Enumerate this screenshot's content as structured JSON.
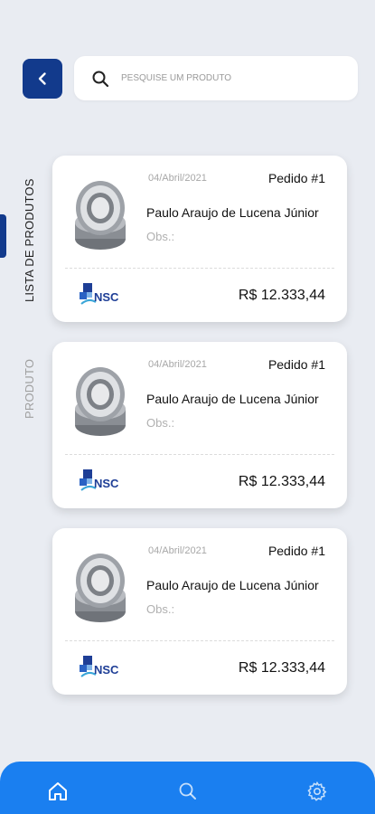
{
  "search": {
    "placeholder": "PESQUISE UM PRODUTO"
  },
  "side_tabs": {
    "active": "LISTA DE PRODUTOS",
    "inactive": "PRODUTO"
  },
  "orders": [
    {
      "date": "04/Abril/2021",
      "order": "Pedido #1",
      "customer": "Paulo Araujo de Lucena Júnior",
      "obs": "Obs.:",
      "price": "R$ 12.333,44",
      "brand": "NSC"
    },
    {
      "date": "04/Abril/2021",
      "order": "Pedido #1",
      "customer": "Paulo Araujo de Lucena Júnior",
      "obs": "Obs.:",
      "price": "R$ 12.333,44",
      "brand": "NSC"
    },
    {
      "date": "04/Abril/2021",
      "order": "Pedido #1",
      "customer": "Paulo Araujo de Lucena Júnior",
      "obs": "Obs.:",
      "price": "R$ 12.333,44",
      "brand": "NSC"
    }
  ],
  "colors": {
    "primary": "#123a8c",
    "nav": "#1a7ff0",
    "background": "#e9ecf2"
  },
  "nav": {
    "items": [
      "home-icon",
      "search-icon",
      "gear-icon"
    ]
  }
}
